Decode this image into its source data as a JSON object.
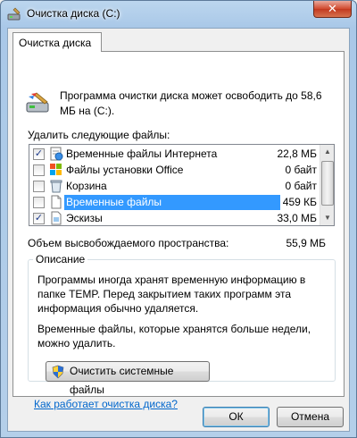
{
  "window": {
    "title": "Очистка диска  (C:)",
    "close_glyph": "✕"
  },
  "tab": {
    "label": "Очистка диска"
  },
  "intro": "Программа очистки диска может освободить до 58,6 МБ на  (C:).",
  "files_label": "Удалить следующие файлы:",
  "files": [
    {
      "name": "Временные файлы Интернета",
      "size": "22,8 МБ",
      "checked": true,
      "icon": "internet-files-icon",
      "selected": false
    },
    {
      "name": "Файлы установки Office",
      "size": "0 байт",
      "checked": false,
      "icon": "office-setup-icon",
      "selected": false
    },
    {
      "name": "Корзина",
      "size": "0 байт",
      "checked": false,
      "icon": "recycle-bin-icon",
      "selected": false
    },
    {
      "name": "Временные файлы",
      "size": "459 КБ",
      "checked": false,
      "icon": "temp-files-icon",
      "selected": true
    },
    {
      "name": "Эскизы",
      "size": "33,0 МБ",
      "checked": true,
      "icon": "thumbnails-icon",
      "selected": false
    }
  ],
  "freed": {
    "label": "Объем высвобождаемого пространства:",
    "value": "55,9 МБ"
  },
  "description": {
    "title": "Описание",
    "text1": "Программы иногда хранят временную информацию в папке TEMP. Перед закрытием таких программ эта информация обычно удаляется.",
    "text2": "Временные файлы, которые хранятся больше недели, можно удалить."
  },
  "clean_button": "Очистить системные файлы",
  "help_link": "Как работает очистка диска?",
  "ok_button": "ОК",
  "cancel_button": "Отмена",
  "colors": {
    "selection": "#3399ff",
    "link": "#0066cc"
  }
}
